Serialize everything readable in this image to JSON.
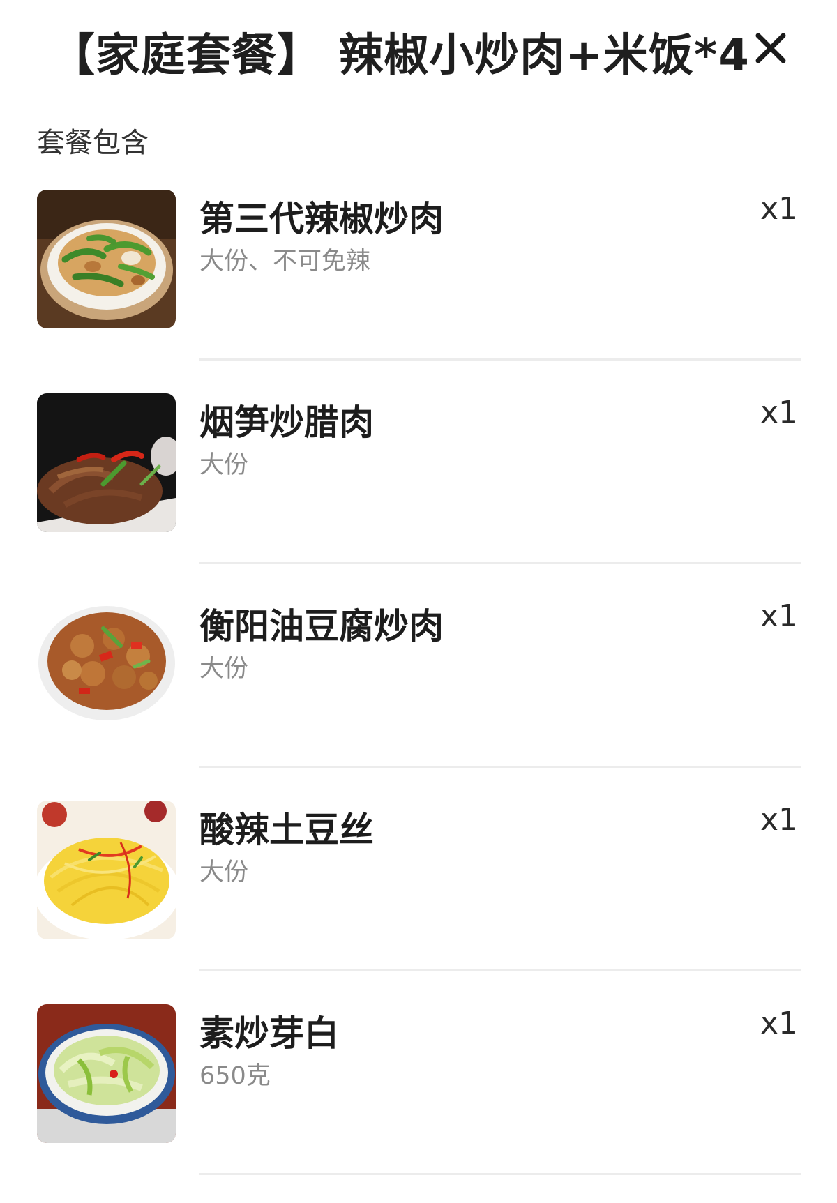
{
  "header": {
    "title": "【家庭套餐】 辣椒小炒肉+米饭*4",
    "close_icon": "close-icon"
  },
  "section": {
    "label": "套餐包含"
  },
  "items": [
    {
      "name": "第三代辣椒炒肉",
      "desc": "大份、不可免辣",
      "qty": "x1",
      "image": "pepper-pork-image"
    },
    {
      "name": "烟笋炒腊肉",
      "desc": "大份",
      "qty": "x1",
      "image": "smoked-bamboo-bacon-image"
    },
    {
      "name": "衡阳油豆腐炒肉",
      "desc": "大份",
      "qty": "x1",
      "image": "fried-tofu-pork-image"
    },
    {
      "name": "酸辣土豆丝",
      "desc": "大份",
      "qty": "x1",
      "image": "potato-shreds-image"
    },
    {
      "name": "素炒芽白",
      "desc": "650克",
      "qty": "x1",
      "image": "stir-fried-cabbage-image"
    }
  ]
}
